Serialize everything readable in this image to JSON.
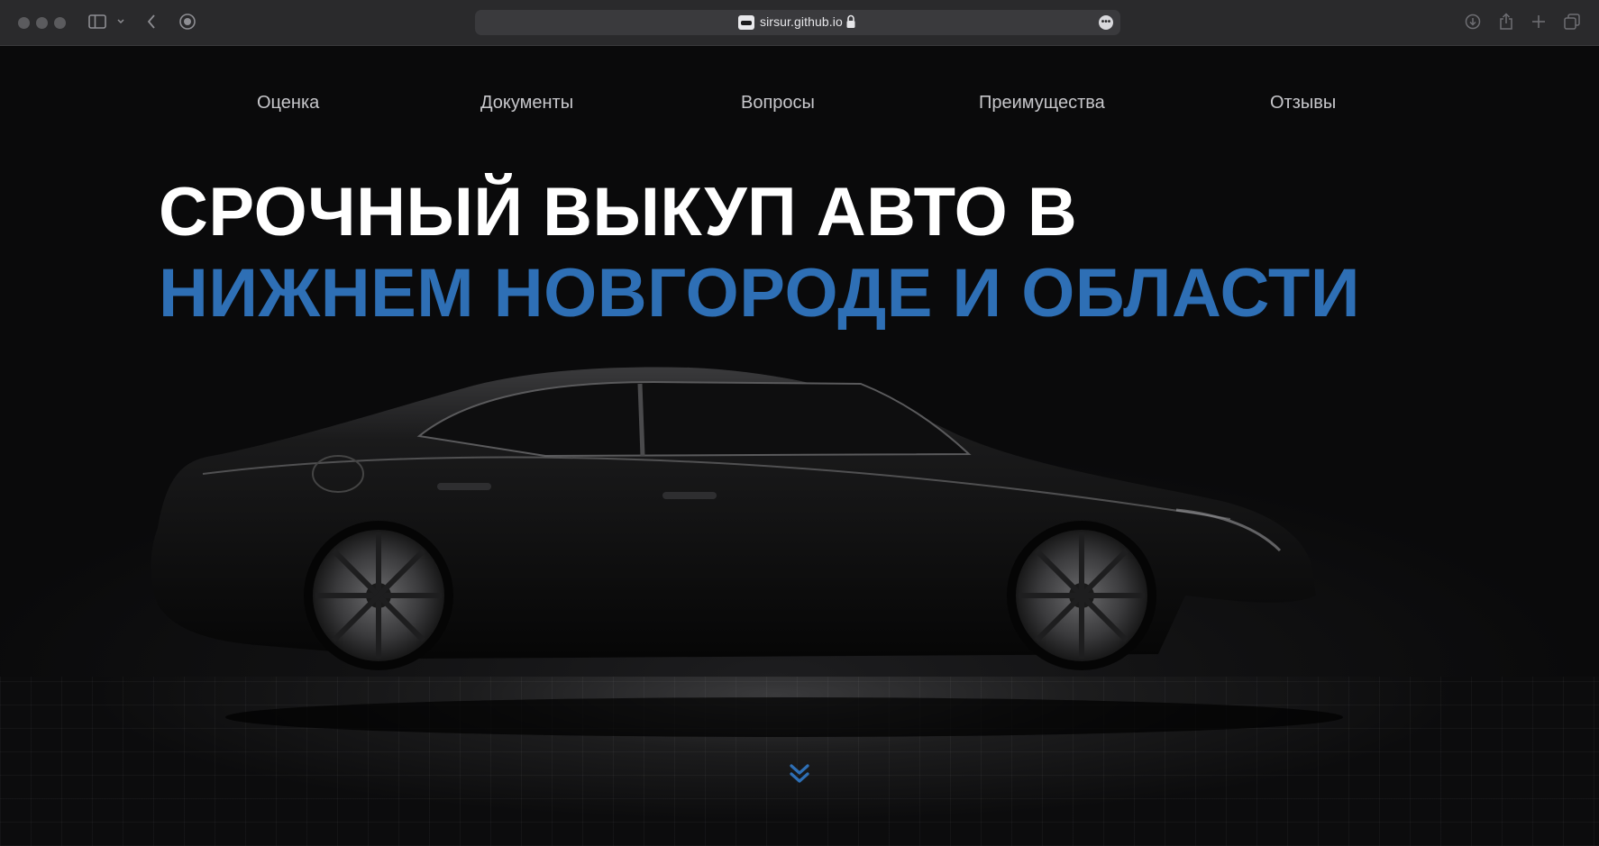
{
  "browser": {
    "url": "sirsur.github.io",
    "icons": [
      "sidebar-icon",
      "chevron-down-icon",
      "back-icon",
      "privacy-report-icon",
      "lock-icon",
      "more-icon",
      "download-icon",
      "share-icon",
      "new-tab-icon",
      "tab-overview-icon"
    ]
  },
  "nav": {
    "items": [
      {
        "label": "Оценка"
      },
      {
        "label": "Документы"
      },
      {
        "label": "Вопросы"
      },
      {
        "label": "Преимущества"
      },
      {
        "label": "Отзывы"
      }
    ]
  },
  "hero": {
    "title_line1": "СРОЧНЫЙ ВЫКУП АВТО В",
    "title_line2": "НИЖНЕМ НОВГОРОДЕ И ОБЛАСТИ",
    "scroll_icon": "double-chevron-down-icon"
  },
  "colors": {
    "accent": "#2e6fb5",
    "background": "#0b0b0c",
    "nav_text": "#c7c7cb"
  }
}
